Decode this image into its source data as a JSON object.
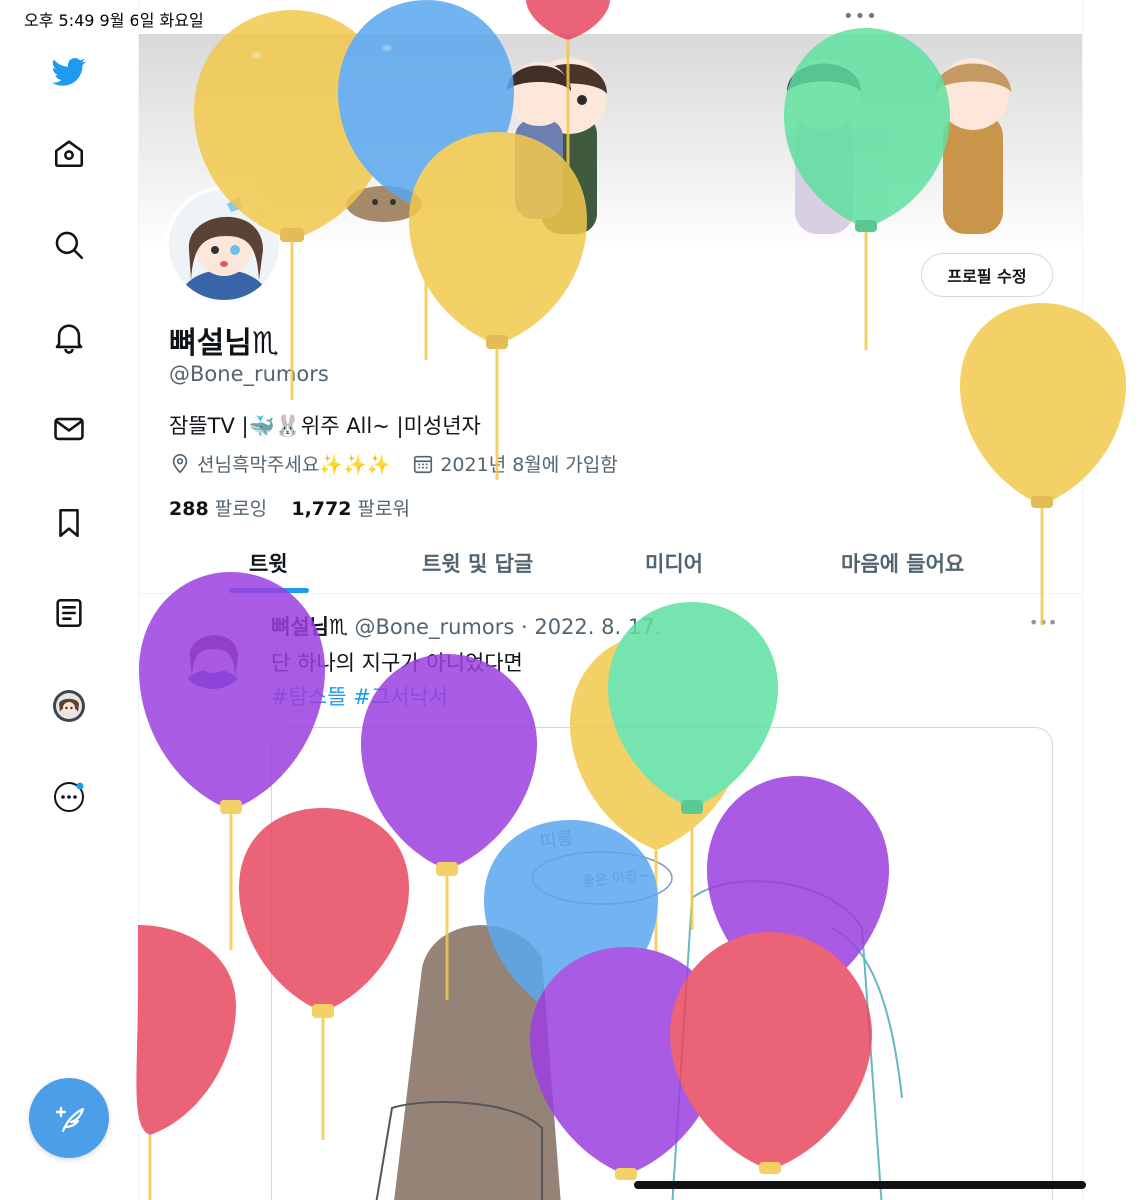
{
  "status_bar": {
    "time": "오후 5:49   9월 6일 화요일",
    "dots": "•••"
  },
  "nav": {
    "logo_icon": "twitter-bird-icon",
    "items": [
      {
        "name": "home",
        "icon": "home-icon"
      },
      {
        "name": "explore",
        "icon": "search-icon"
      },
      {
        "name": "notifications",
        "icon": "bell-icon"
      },
      {
        "name": "messages",
        "icon": "mail-icon"
      },
      {
        "name": "bookmarks",
        "icon": "bookmark-icon"
      },
      {
        "name": "lists",
        "icon": "list-icon"
      },
      {
        "name": "profile",
        "icon": "avatar-icon"
      },
      {
        "name": "more",
        "icon": "more-icon"
      }
    ],
    "compose_icon": "compose-feather-icon"
  },
  "profile": {
    "display_name": "뼈설님",
    "name_symbol": "♏",
    "handle": "@Bone_rumors",
    "bio": "잠뜰TV |🐳🐰위주 All~ |미성년자",
    "location": "션님흑막주세요✨✨✨",
    "joined": "2021년 8월에 가입함",
    "following_count": "288",
    "following_label": "팔로잉",
    "followers_count": "1,772",
    "followers_label": "팔로워",
    "edit_button": "프로필 수정"
  },
  "tabs": [
    "트윗",
    "트윗 및 답글",
    "미디어",
    "마음에 들어요"
  ],
  "tweet": {
    "name": "뼈설님♏",
    "handle": "@Bone_rumors",
    "date": "· 2022. 8. 17.",
    "text": "단 하나의 지구가 아니었다면",
    "hashtags": "#탐스뜰 #그서낙서",
    "more": "•••",
    "media_text_1": "띠롱",
    "media_text_2": "좋은 아침~"
  },
  "colors": {
    "accent": "#1d9bf0",
    "compose_bg": "#4a9fe8",
    "balloon_yellow": "#f2c94c",
    "balloon_blue": "#5aa8ef",
    "balloon_green": "#5fe0a0",
    "balloon_purple": "#9b3fe0",
    "balloon_red": "#e8485f"
  }
}
